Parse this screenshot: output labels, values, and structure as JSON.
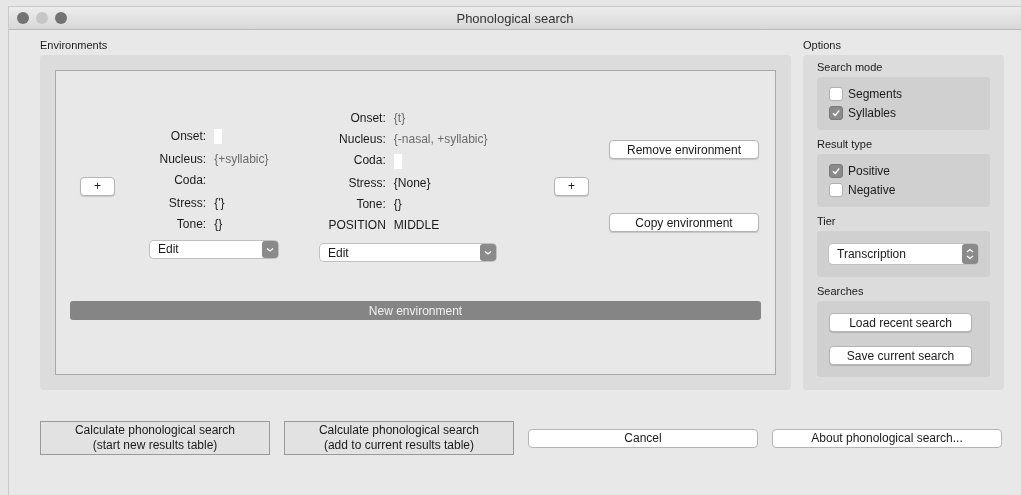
{
  "window": {
    "title": "Phonological search"
  },
  "environments": {
    "label": "Environments",
    "add_left": "+",
    "add_right": "+",
    "items": [
      {
        "fields": [
          {
            "label": "Onset:",
            "kind": "input"
          },
          {
            "label": "Nucleus:",
            "value": "{+syllabic}",
            "kind": "feature"
          },
          {
            "label": "Coda:",
            "kind": "empty"
          },
          {
            "label": "Stress:",
            "value": "{'}",
            "kind": "plain"
          },
          {
            "label": "Tone:",
            "value": "{}",
            "kind": "plain"
          }
        ],
        "edit": "Edit"
      },
      {
        "fields": [
          {
            "label": "Onset:",
            "value": "{t}",
            "kind": "feature"
          },
          {
            "label": "Nucleus:",
            "value": "{-nasal, +syllabic}",
            "kind": "feature"
          },
          {
            "label": "Coda:",
            "kind": "input"
          },
          {
            "label": "Stress:",
            "value": "{None}",
            "kind": "plain"
          },
          {
            "label": "Tone:",
            "value": "{}",
            "kind": "plain"
          },
          {
            "label": "POSITION",
            "value": "MIDDLE",
            "kind": "plain"
          }
        ],
        "edit": "Edit"
      }
    ],
    "remove": "Remove environment",
    "copy": "Copy environment",
    "new_environment": "New environment"
  },
  "options": {
    "label": "Options",
    "groups": [
      {
        "title": "Search mode",
        "kind": "checkboxes",
        "items": [
          {
            "label": "Segments",
            "checked": false
          },
          {
            "label": "Syllables",
            "checked": true
          }
        ]
      },
      {
        "title": "Result type",
        "kind": "checkboxes",
        "items": [
          {
            "label": "Positive",
            "checked": true
          },
          {
            "label": "Negative",
            "checked": false
          }
        ]
      },
      {
        "title": "Tier",
        "kind": "select",
        "value": "Transcription"
      },
      {
        "title": "Searches",
        "kind": "buttons",
        "items": [
          "Load recent search",
          "Save current search"
        ]
      }
    ]
  },
  "buttons": [
    {
      "lines": [
        "Calculate phonological search",
        "(start new results table)"
      ],
      "kind": "square"
    },
    {
      "lines": [
        "Calculate phonological search",
        "(add to current results table)"
      ],
      "kind": "square"
    },
    {
      "lines": [
        "Cancel"
      ],
      "kind": "round"
    },
    {
      "lines": [
        "About phonological search..."
      ],
      "kind": "round"
    }
  ]
}
